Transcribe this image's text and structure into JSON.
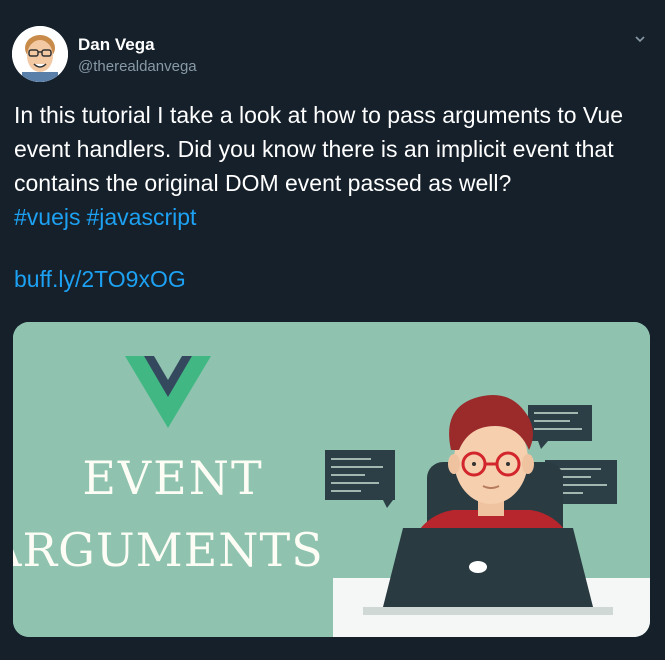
{
  "tweet": {
    "author": {
      "display_name": "Dan Vega",
      "handle": "@therealdanvega",
      "avatar_icon": "cartoon-avatar-icon"
    },
    "menu_icon": "chevron-down-icon",
    "text": "In this tutorial I take a look at how to pass arguments to Vue event handlers. Did you know there is an implicit event that contains the original DOM event passed as well?",
    "hashtags": [
      "#vuejs",
      "#javascript"
    ],
    "link": "buff.ly/2TO9xOG"
  },
  "card": {
    "title_line_1": "EVENT",
    "title_line_2": "ARGUMENTS",
    "logo_icon": "vue-logo-icon",
    "illustration": "developer-at-laptop-illustration",
    "colors": {
      "background": "#8fc3af",
      "vue_green": "#41b883",
      "vue_dark": "#35495e"
    }
  },
  "colors": {
    "page_background": "#15202b",
    "link": "#1da1f2",
    "secondary_text": "#8899a6"
  }
}
